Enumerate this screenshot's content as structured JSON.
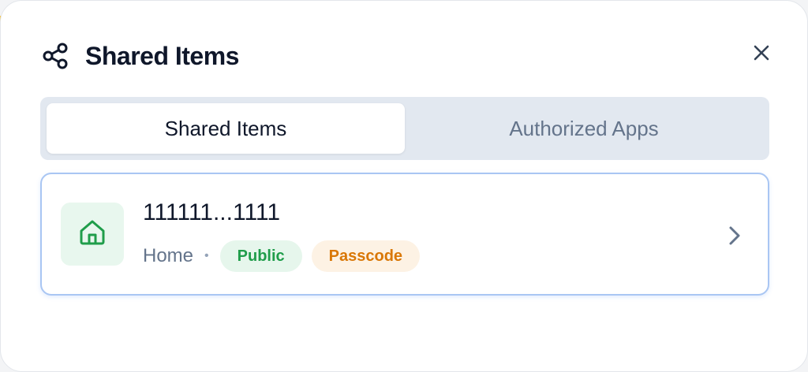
{
  "modal": {
    "title": "Shared Items",
    "icons": {
      "title_icon": "share-icon",
      "close_icon": "close-icon"
    }
  },
  "tabs": [
    {
      "label": "Shared Items",
      "active": true
    },
    {
      "label": "Authorized Apps",
      "active": false
    }
  ],
  "items": [
    {
      "name": "111111...1111",
      "type": "Home",
      "separator": "•",
      "icon": "home-icon",
      "badges": [
        {
          "label": "Public",
          "color": "#1f9d4a",
          "bg": "#e6f6ec"
        },
        {
          "label": "Passcode",
          "color": "#d97706",
          "bg": "#fdf2e4"
        }
      ]
    }
  ],
  "colors": {
    "accent_blue_border": "#a9c6f3",
    "text_primary": "#0f172a",
    "text_muted": "#64748b"
  }
}
